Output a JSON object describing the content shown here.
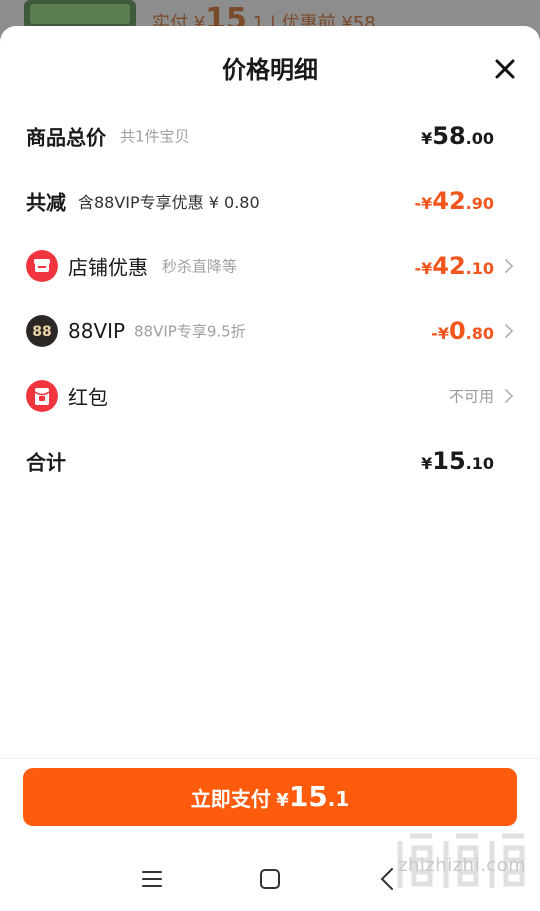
{
  "background_peek": {
    "text_prefix": "实付",
    "currency": "¥",
    "int": "15",
    "dec": ".1",
    "separator": "|",
    "original_label": "优惠前 ¥58"
  },
  "sheet": {
    "title": "价格明细"
  },
  "rows": {
    "total": {
      "label": "商品总价",
      "sub": "共1件宝贝",
      "currency": "¥",
      "int": "58",
      "dec": ".00"
    },
    "discount": {
      "label": "共减",
      "sub": "含88VIP专享优惠 ¥ 0.80",
      "currency": "-¥",
      "int": "42",
      "dec": ".90"
    },
    "store": {
      "label": "店铺优惠",
      "sub": "秒杀直降等",
      "currency": "-¥",
      "int": "42",
      "dec": ".10",
      "icon": "store-icon"
    },
    "vip": {
      "label": "88VIP",
      "sub": "88VIP专享9.5折",
      "currency": "-¥",
      "int": "0",
      "dec": ".80",
      "icon": "88vip-icon"
    },
    "redpacket": {
      "label": "红包",
      "status": "不可用",
      "icon": "red-packet-icon"
    },
    "sum": {
      "label": "合计",
      "currency": "¥",
      "int": "15",
      "dec": ".10"
    }
  },
  "pay_button": {
    "label": "立即支付",
    "currency": "¥",
    "int": "15",
    "dec": ".1"
  },
  "watermark": {
    "site": "zhizhizhi.com"
  },
  "colors": {
    "accent": "#ff5b0d",
    "discount": "#f2561d",
    "store_icon": "#f0353f",
    "vip_icon": "#2c2724"
  }
}
